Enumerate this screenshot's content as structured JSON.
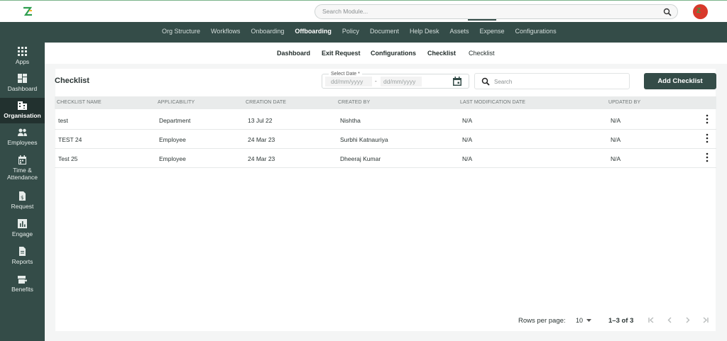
{
  "search": {
    "placeholder": "Search Module..."
  },
  "modules": [
    "Org Structure",
    "Workflows",
    "Onboarding",
    "Offboarding",
    "Policy",
    "Document",
    "Help Desk",
    "Assets",
    "Expense",
    "Configurations"
  ],
  "sidebar": {
    "items": [
      {
        "label": "Apps",
        "icon": "apps-icon"
      },
      {
        "label": "Dashboard",
        "icon": "dashboard-icon"
      },
      {
        "label": "Organisation",
        "icon": "organisation-icon"
      },
      {
        "label": "Employees",
        "icon": "employees-icon"
      },
      {
        "label": "Time &",
        "label2": "Attendance",
        "icon": "calendar-icon"
      },
      {
        "label": "Request",
        "icon": "request-icon"
      },
      {
        "label": "Engage",
        "icon": "engage-icon"
      },
      {
        "label": "Reports",
        "icon": "reports-icon"
      },
      {
        "label": "Benefits",
        "icon": "benefits-icon"
      }
    ]
  },
  "subtabs": [
    "Dashboard",
    "Exit Request",
    "Configurations",
    "Checklist",
    "Checklist"
  ],
  "page": {
    "title": "Checklist",
    "date_label": "Select Date *",
    "date_from_placeholder": "dd/mm/yyyy",
    "date_separator": "-",
    "date_to_placeholder": "dd/mm/yyyy",
    "search_placeholder": "Search",
    "add_button": "Add Checklist"
  },
  "table": {
    "columns": [
      "CHECKLIST NAME",
      "APPLICABILITY",
      "CREATION DATE",
      "CREATED BY",
      "LAST MODIFICATION DATE",
      "UPDATED BY"
    ],
    "rows": [
      [
        "test",
        "Department",
        "13 Jul 22",
        "Nishtha",
        "N/A",
        "N/A"
      ],
      [
        "TEST 24",
        "Employee",
        "24 Mar 23",
        "Surbhi Katnauriya",
        "N/A",
        "N/A"
      ],
      [
        "Test 25",
        "Employee",
        "24 Mar 23",
        "Dheeraj Kumar",
        "N/A",
        "N/A"
      ]
    ]
  },
  "pagination": {
    "rows_per_page_label": "Rows per page:",
    "rows_per_page_value": "10",
    "range": "1–3 of 3"
  },
  "colors": {
    "primary": "#344c48",
    "sidebar_active": "#22312f",
    "avatar": "#d8392b"
  }
}
